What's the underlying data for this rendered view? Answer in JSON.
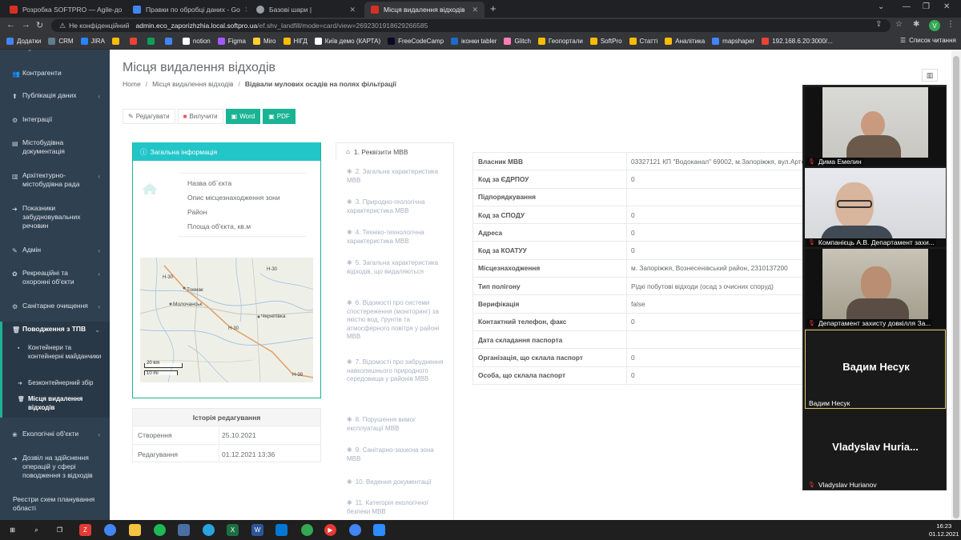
{
  "browser": {
    "tabs": [
      {
        "title": "Розробка SOFTPRO — Agile-до",
        "color": "#d93025"
      },
      {
        "title": "Правки по обробці даних - Go",
        "color": "#4285f4"
      },
      {
        "title": "Базові шари |",
        "color": "#9aa0a6"
      },
      {
        "title": "Місця видалення відходів",
        "color": "#d93025"
      }
    ],
    "not_secure": "Не конфіденційний",
    "url_host": "admin.eco_zaporizhzhia.local.softpro.ua",
    "url_path": "/ef.shv_landfill/mode=card/view=2692301918629266585",
    "profile_initial": "V"
  },
  "bookmarks": [
    {
      "label": "Додатки",
      "color": "#4285f4"
    },
    {
      "label": "CRM",
      "color": "#607d8b"
    },
    {
      "label": "JIRA",
      "color": "#2684ff"
    },
    {
      "label": "",
      "color": "#fbbc04"
    },
    {
      "label": "",
      "color": "#ea4335"
    },
    {
      "label": "",
      "color": "#0f9d58"
    },
    {
      "label": "",
      "color": "#4285f4"
    },
    {
      "label": "notion",
      "color": "#ffffff"
    },
    {
      "label": "Figma",
      "color": "#a259ff"
    },
    {
      "label": "Miro",
      "color": "#ffd02f"
    },
    {
      "label": "НІГД",
      "color": "#fbbc04"
    },
    {
      "label": "Київ демо (КАРТА)",
      "color": "#ffffff"
    },
    {
      "label": "FreeCodeCamp",
      "color": "#0a0a23"
    },
    {
      "label": "іконки tabler",
      "color": "#206bc4"
    },
    {
      "label": "Glitch",
      "color": "#ff7eb6"
    },
    {
      "label": "Геопортали",
      "color": "#fbbc04"
    },
    {
      "label": "SoftPro",
      "color": "#fbbc04"
    },
    {
      "label": "Статті",
      "color": "#fbbc04"
    },
    {
      "label": "Аналітика",
      "color": "#fbbc04"
    },
    {
      "label": "mapshaper",
      "color": "#4285f4"
    },
    {
      "label": "192.168.6.20:3000/...",
      "color": "#ea4335"
    }
  ],
  "bookmarks_reading_list": "Список читання",
  "sidebar": {
    "items": [
      {
        "label": "Контрагенти",
        "icon": "users-icon",
        "chevron": false
      },
      {
        "label": "Публікація даних",
        "icon": "upload-icon",
        "chevron": true
      },
      {
        "label": "Інтеграції",
        "icon": "integration-icon",
        "chevron": false
      },
      {
        "label": "Містобудівна документація",
        "icon": "document-icon",
        "chevron": false
      },
      {
        "label": "Архітектурно-містобудівна рада",
        "icon": "building-icon",
        "chevron": true
      },
      {
        "label": "Показники забудновувальних речовин",
        "icon": "arrow-icon",
        "chevron": false
      },
      {
        "label": "Адмін",
        "icon": "wrench-icon",
        "chevron": true
      },
      {
        "label": "Рекреаційні та охоронні об'єкти",
        "icon": "leaf-icon",
        "chevron": true
      },
      {
        "label": "Санітарне очищення",
        "icon": "gear-icon",
        "chevron": true
      },
      {
        "label": "Поводження з ТПВ",
        "icon": "trash-icon",
        "chevron": true
      },
      {
        "label": "Екологічні об'єкти",
        "icon": "eco-icon",
        "chevron": true
      },
      {
        "label": "Дозвіл на здійснення операцій у сфері поводження з відходів",
        "icon": "arrow-icon",
        "chevron": false
      },
      {
        "label": "Реєстри схем планування області",
        "icon": "",
        "chevron": false
      }
    ],
    "subitems": [
      {
        "label": "Контейнери та контейнерні майданчики"
      },
      {
        "label": "Безконтейнерний збір"
      },
      {
        "label": "Місця видалення відходів"
      }
    ]
  },
  "page": {
    "title": "Місця видалення відходів",
    "breadcrumb": [
      "Home",
      "Місця видалення відходів",
      "Відвали мулових осадів на полях фільтрації"
    ]
  },
  "toolbar": {
    "edit": "Редагувати",
    "delete": "Вилучити",
    "word": "Word",
    "pdf": "PDF"
  },
  "info": {
    "heading": "Загальна інформація",
    "labels": [
      "Назва об`єкта",
      "Опис місцезнаходження зони",
      "Район",
      "Площа об'єкта, кв.м"
    ]
  },
  "map": {
    "labels": [
      "Н-30",
      "Токмак",
      "Молочанськ",
      "Н-30",
      "Чернігівка",
      "Н-30",
      "Н-39"
    ],
    "scale_km": "20 km",
    "scale_mi": "10 mi"
  },
  "history": {
    "heading": "Історія редагування",
    "rows": [
      {
        "key": "Створення",
        "value": "25.10.2021"
      },
      {
        "key": "Редагування",
        "value": "01.12.2021 13:36"
      }
    ]
  },
  "tabs": {
    "active": "1. Реквізити МВВ",
    "items": [
      "2. Загальна характеристика МВВ",
      "3. Природно-геологічна характеристика МВВ",
      "4. Техніко-технологічна характеристика МВВ",
      "5. Загальна характеристика відходів, що видаляються",
      "6. Відомості про системи спостереження (моніторинг) за якістю вод, ґрунтів та атмосферного повітря у районі МВВ",
      "7. Відомості про забруднення навколишнього природного середовища у районів МВВ",
      "8. Порушення вимог експлуатації МВВ",
      "9. Санітарно-захисна зона МВВ",
      "10. Ведення документації",
      "11. Категорія екологічної безпеки МВВ"
    ]
  },
  "details": [
    {
      "key": "Власник МВВ",
      "value": "03327121 КП \"Водоканал\" 69002, м.Запоріжжя, вул.Артема, 1"
    },
    {
      "key": "Код за ЄДРПОУ",
      "value": "0"
    },
    {
      "key": "Підпорядкування",
      "value": ""
    },
    {
      "key": "Код за СПОДУ",
      "value": "0"
    },
    {
      "key": "Адреса",
      "value": "0"
    },
    {
      "key": "Код за КОАТУУ",
      "value": "0"
    },
    {
      "key": "Місцезнаходження",
      "value": "м. Запоріжжя, Вознесенівський район, 2310137200"
    },
    {
      "key": "Тип полігону",
      "value": "Рідкі побутові відходи (осад з очисних споруд)"
    },
    {
      "key": "Верифікація",
      "value": "false"
    },
    {
      "key": "Контактний телефон, факс",
      "value": "0"
    },
    {
      "key": "Дата складання паспорта",
      "value": ""
    },
    {
      "key": "Організація, що склала паспорт",
      "value": "0"
    },
    {
      "key": "Особа, що склала паспорт",
      "value": "0"
    }
  ],
  "video": {
    "participants": [
      {
        "name": "Дима Емелин",
        "big": ""
      },
      {
        "name": "Компанієць А.В. Департамент захи...",
        "big": ""
      },
      {
        "name": "Департамент захисту довкілля За...",
        "big": ""
      },
      {
        "name": "Вадим Несук",
        "big": "Вадим Несук"
      },
      {
        "name": "Vladyslav Hurianov",
        "big": "Vladyslav  Huria..."
      }
    ]
  },
  "taskbar": {
    "time": "16:23",
    "date": "01.12.2021"
  }
}
